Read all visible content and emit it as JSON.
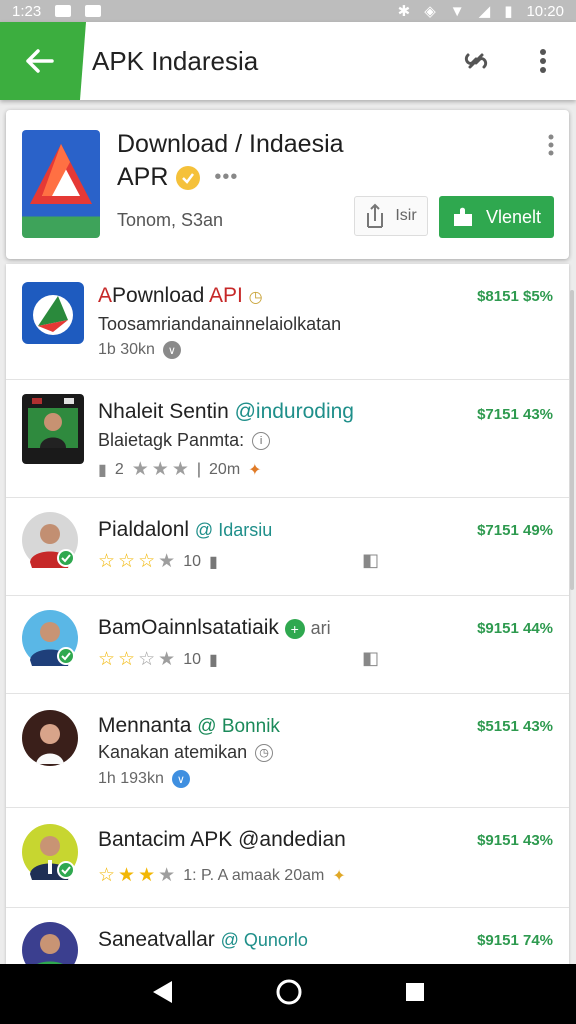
{
  "status_bar": {
    "time_left": "1:23",
    "time_right": "10:20"
  },
  "toolbar": {
    "title": "APK Indaresia"
  },
  "app_card": {
    "title": "Download / Indaesia",
    "subtitle": "APR",
    "developer": "Tonom, S3an",
    "share_label": "Isir",
    "install_label": "Vlenelt"
  },
  "list": [
    {
      "title_prefix": "A",
      "title_main": "Pownload",
      "title_red": "API",
      "line2": "Toosamriandanainnelaiolkatan",
      "meta": "1b 30kn",
      "price": "$8151 $5%"
    },
    {
      "title_main": "Nhaleit Sentin",
      "title_acc": "@induroding",
      "line2": "Blaietagk Panmta:",
      "meta_count": "2",
      "meta_extra": "20m",
      "price": "$7151 43%"
    },
    {
      "title_main": "Pialdalonl",
      "title_acc": "@ Idarsiu",
      "rating_count": "10",
      "price": "$7151 49%"
    },
    {
      "title_main": "BamOainnlsatatiaik",
      "title_acc": "ari",
      "rating_count": "10",
      "price": "$9151 44%"
    },
    {
      "title_main": "Mennanta",
      "title_acc": "@ Bonnik",
      "line2": "Kanakan atemikan",
      "meta": "1h 193kn",
      "price": "$5151 43%"
    },
    {
      "title_main": "Bantacim APK",
      "title_acc": "@andedian",
      "meta_extra": "1: P. A amaak 20am",
      "price": "$9151 43%"
    },
    {
      "title_main": "Saneatvallar",
      "title_acc": "@ Qunorlo",
      "price": "$9151 74%"
    }
  ],
  "colors": {
    "brand_green": "#3cae3f",
    "install_green": "#2fa84f",
    "price_green": "#2e9a4f",
    "accent_teal": "#1f8f8a"
  }
}
